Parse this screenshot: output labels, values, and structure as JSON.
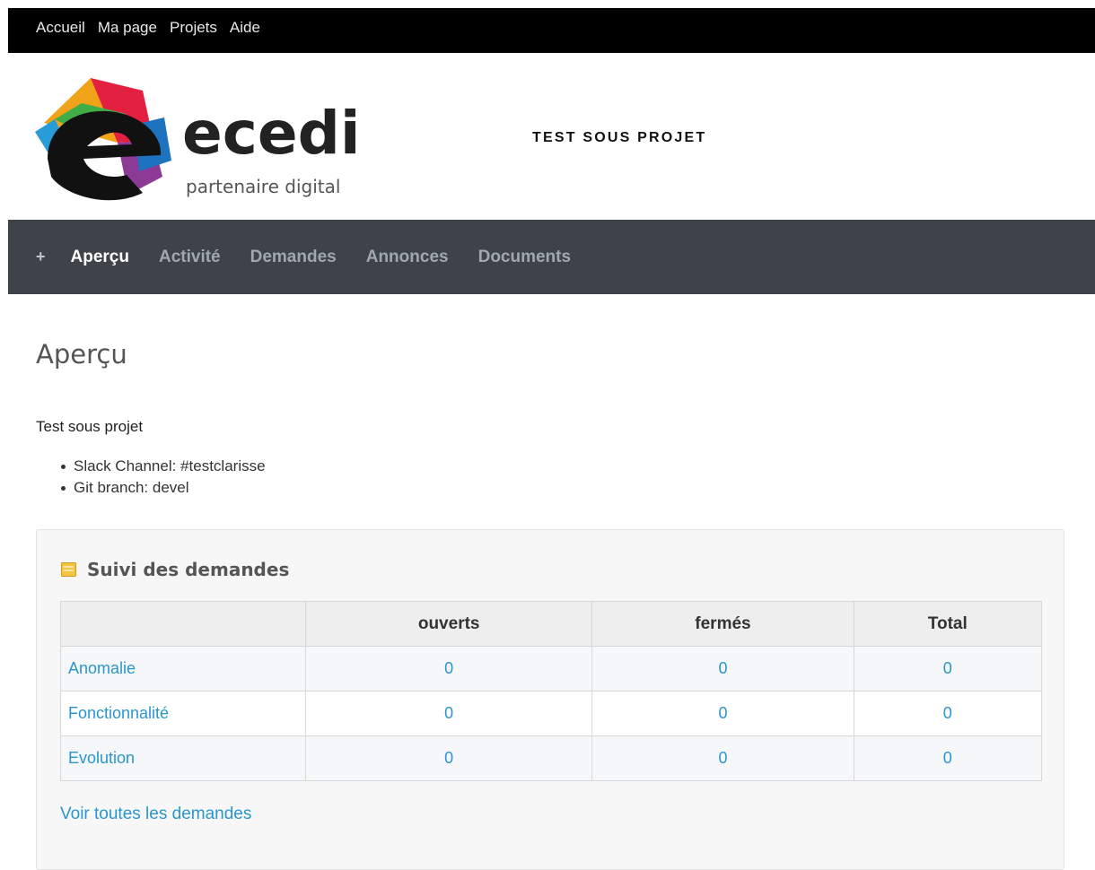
{
  "top_menu": [
    "Accueil",
    "Ma page",
    "Projets",
    "Aide"
  ],
  "header": {
    "logo_text": "ecedi",
    "logo_tagline": "partenaire digital",
    "project_title": "TEST SOUS PROJET"
  },
  "main_menu": {
    "plus": "+",
    "tabs": [
      "Aperçu",
      "Activité",
      "Demandes",
      "Annonces",
      "Documents"
    ],
    "selected": "Aperçu"
  },
  "page": {
    "title": "Aperçu",
    "description": "Test sous projet",
    "info": [
      "Slack Channel: #testclarisse",
      "Git branch: devel"
    ]
  },
  "issues": {
    "heading": "Suivi des demandes",
    "columns": [
      "",
      "ouverts",
      "fermés",
      "Total"
    ],
    "rows": [
      {
        "name": "Anomalie",
        "open": "0",
        "closed": "0",
        "total": "0"
      },
      {
        "name": "Fonctionnalité",
        "open": "0",
        "closed": "0",
        "total": "0"
      },
      {
        "name": "Evolution",
        "open": "0",
        "closed": "0",
        "total": "0"
      }
    ],
    "view_all": "Voir toutes les demandes"
  }
}
